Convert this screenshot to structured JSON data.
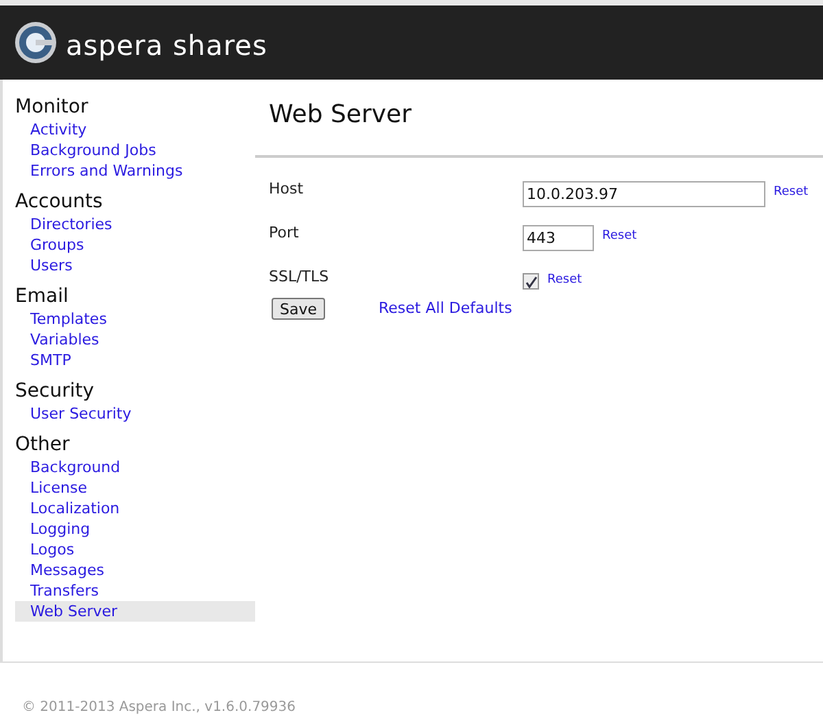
{
  "header": {
    "title": "aspera shares"
  },
  "sidebar": {
    "sections": [
      {
        "heading": "Monitor",
        "items": [
          {
            "label": "Activity",
            "selected": false
          },
          {
            "label": "Background Jobs",
            "selected": false
          },
          {
            "label": "Errors and Warnings",
            "selected": false
          }
        ]
      },
      {
        "heading": "Accounts",
        "items": [
          {
            "label": "Directories",
            "selected": false
          },
          {
            "label": "Groups",
            "selected": false
          },
          {
            "label": "Users",
            "selected": false
          }
        ]
      },
      {
        "heading": "Email",
        "items": [
          {
            "label": "Templates",
            "selected": false
          },
          {
            "label": "Variables",
            "selected": false
          },
          {
            "label": "SMTP",
            "selected": false
          }
        ]
      },
      {
        "heading": "Security",
        "items": [
          {
            "label": "User Security",
            "selected": false
          }
        ]
      },
      {
        "heading": "Other",
        "items": [
          {
            "label": "Background",
            "selected": false
          },
          {
            "label": "License",
            "selected": false
          },
          {
            "label": "Localization",
            "selected": false
          },
          {
            "label": "Logging",
            "selected": false
          },
          {
            "label": "Logos",
            "selected": false
          },
          {
            "label": "Messages",
            "selected": false
          },
          {
            "label": "Transfers",
            "selected": false
          },
          {
            "label": "Web Server",
            "selected": true
          }
        ]
      }
    ]
  },
  "main": {
    "title": "Web Server",
    "fields": [
      {
        "kind": "text",
        "label": "Host",
        "value": "10.0.203.97",
        "reset": "Reset"
      },
      {
        "kind": "number",
        "label": "Port",
        "value": "443",
        "reset": "Reset"
      },
      {
        "kind": "checkbox",
        "label": "SSL/TLS",
        "checked": true,
        "reset": "Reset"
      }
    ],
    "save": "Save",
    "reset_all": "Reset All Defaults"
  },
  "footer": "© 2011-2013 Aspera Inc., v1.6.0.79936"
}
